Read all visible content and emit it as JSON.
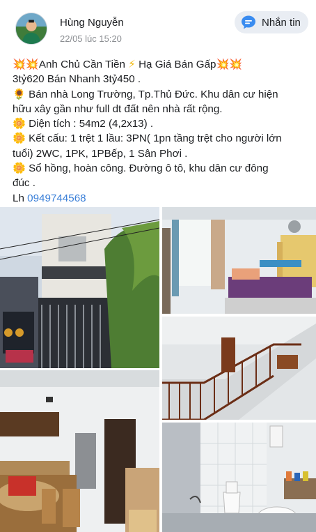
{
  "post": {
    "author": "Hùng Nguyễn",
    "timestamp": "22/05 lúc 15:20",
    "message_button": "Nhắn tin",
    "lines": [
      {
        "prefix": "💥💥",
        "text": "Anh Chủ Cần Tiền ",
        "mid": "⚡",
        "text2": " Hạ Giá Bán Gấp",
        "suffix": "💥💥"
      },
      {
        "text": "3tỷ620 Bán Nhanh 3tỷ450 ."
      },
      {
        "prefix": "🌻",
        "text": " Bán nhà Long Trường, Tp.Thủ Đức. Khu dân cư hiện"
      },
      {
        "text": "hữu xây gần như full dt đất nên nhà rất rộng."
      },
      {
        "prefix": "🌼",
        "text": " Diện tích : 54m2 (4,2x13) ."
      },
      {
        "prefix": "🌼",
        "text": " Kết cấu: 1 trệt 1 lầu: 3PN( 1pn tầng trệt cho người lớn"
      },
      {
        "text": "tuổi) 2WC, 1PK, 1PBếp, 1 Sân Phơi ."
      },
      {
        "prefix": "🌼",
        "text": " Sổ hồng, hoàn công. Đường ô tô, khu dân cư đông"
      },
      {
        "text": "đúc ."
      }
    ],
    "contact_prefix": "Lh ",
    "phone": "0949744568"
  },
  "icons": {
    "avatar": "profile-photo",
    "message": "messenger-bubble-icon"
  },
  "colors": {
    "accent": "#3a7fd8",
    "button_bg": "#e9edf3",
    "muted": "#8a8d91"
  },
  "photos": [
    {
      "name": "house-facade-photo"
    },
    {
      "name": "bedroom-photo"
    },
    {
      "name": "staircase-photo"
    },
    {
      "name": "kitchen-photo"
    },
    {
      "name": "bathroom-photo"
    }
  ]
}
